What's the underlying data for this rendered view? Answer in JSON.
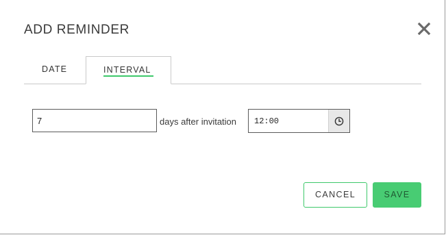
{
  "dialog": {
    "title": "ADD REMINDER",
    "close_icon": "close-icon"
  },
  "tabs": [
    {
      "label": "DATE",
      "active": false
    },
    {
      "label": "INTERVAL",
      "active": true
    }
  ],
  "interval": {
    "days_value": "7",
    "days_label": "days after invitation",
    "time_value": "12:00",
    "clock_icon": "clock-icon"
  },
  "actions": {
    "cancel_label": "CANCEL",
    "save_label": "SAVE"
  },
  "colors": {
    "accent": "#48cc73",
    "tab_underline": "#3dc86a",
    "cancel_border": "#3dc86a"
  }
}
